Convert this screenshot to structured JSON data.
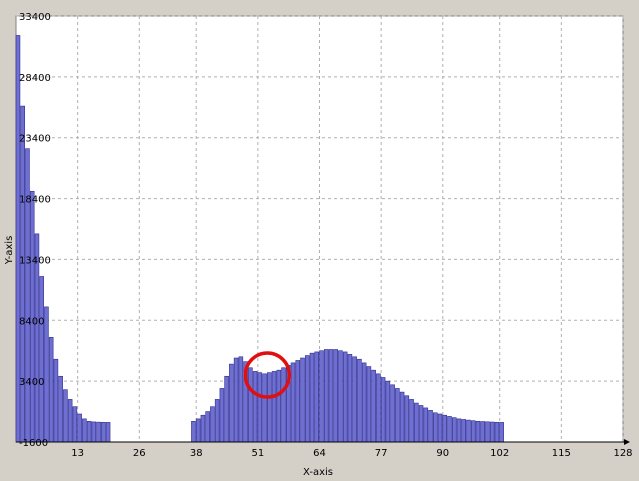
{
  "chart_data": {
    "type": "bar",
    "xlabel": "X-axis",
    "ylabel": "Y-axis",
    "xlim": [
      0,
      128
    ],
    "ylim": [
      -1600,
      33400
    ],
    "x_ticks": [
      13,
      26,
      38,
      51,
      64,
      77,
      90,
      102,
      115,
      128
    ],
    "y_ticks": [
      -1600,
      3400,
      8400,
      13400,
      18400,
      23400,
      28400,
      33400
    ],
    "grid": true,
    "bar_color": "#6f6fd2",
    "bar_edge_color": "#2b2b8f",
    "highlight_color": "#e01010",
    "highlight_center": {
      "x": 53,
      "y": 3900
    },
    "x": [
      0,
      1,
      2,
      3,
      4,
      5,
      6,
      7,
      8,
      9,
      10,
      11,
      12,
      13,
      14,
      15,
      16,
      17,
      18,
      19,
      20,
      21,
      22,
      23,
      24,
      25,
      26,
      27,
      28,
      29,
      30,
      31,
      32,
      33,
      34,
      35,
      36,
      37,
      38,
      39,
      40,
      41,
      42,
      43,
      44,
      45,
      46,
      47,
      48,
      49,
      50,
      51,
      52,
      53,
      54,
      55,
      56,
      57,
      58,
      59,
      60,
      61,
      62,
      63,
      64,
      65,
      66,
      67,
      68,
      69,
      70,
      71,
      72,
      73,
      74,
      75,
      76,
      77,
      78,
      79,
      80,
      81,
      82,
      83,
      84,
      85,
      86,
      87,
      88,
      89,
      90,
      91,
      92,
      93,
      94,
      95,
      96,
      97,
      98,
      99,
      100,
      101,
      102,
      103,
      104,
      105,
      106,
      107,
      108,
      109,
      110,
      111,
      112,
      113,
      114,
      115,
      116,
      117,
      117,
      119,
      120,
      121,
      122,
      123,
      124,
      125,
      126,
      127
    ],
    "values": [
      31800,
      26000,
      22500,
      19000,
      15500,
      12000,
      9500,
      7000,
      5200,
      3800,
      2700,
      1900,
      1300,
      700,
      300,
      100,
      50,
      30,
      20,
      10,
      0,
      0,
      0,
      0,
      0,
      0,
      0,
      0,
      0,
      0,
      0,
      0,
      0,
      0,
      0,
      0,
      0,
      100,
      300,
      600,
      900,
      1300,
      1900,
      2800,
      3800,
      4800,
      5300,
      5400,
      5000,
      4500,
      4200,
      4100,
      4000,
      4100,
      4200,
      4300,
      4500,
      4700,
      4900,
      5100,
      5300,
      5500,
      5700,
      5800,
      5900,
      6000,
      6000,
      6000,
      5900,
      5800,
      5600,
      5400,
      5200,
      4900,
      4600,
      4300,
      4000,
      3700,
      3400,
      3100,
      2800,
      2500,
      2200,
      1900,
      1600,
      1400,
      1200,
      1000,
      800,
      700,
      600,
      500,
      400,
      300,
      250,
      200,
      150,
      100,
      80,
      60,
      40,
      20,
      10,
      0,
      0,
      0,
      0,
      0,
      0,
      0,
      0,
      0,
      0,
      0,
      0,
      0,
      0,
      0,
      0,
      0,
      0,
      0,
      0,
      0,
      0,
      0,
      0,
      0,
      0
    ]
  }
}
